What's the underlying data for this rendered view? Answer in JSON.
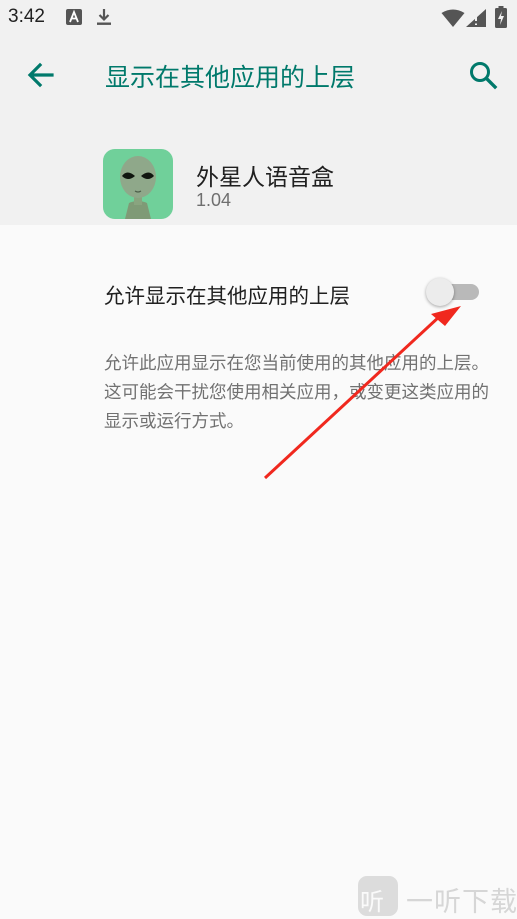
{
  "status_bar": {
    "time": "3:42",
    "icons": [
      "keyboard-a-icon",
      "download-icon",
      "wifi-icon",
      "signal-icon",
      "battery-charging-icon"
    ]
  },
  "app_bar": {
    "back_icon": "arrow-left-icon",
    "title": "显示在其他应用的上层",
    "search_icon": "search-icon"
  },
  "app_info": {
    "name": "外星人语音盒",
    "version": "1.04",
    "icon": "alien-app-icon"
  },
  "setting": {
    "label": "允许显示在其他应用的上层",
    "enabled": false
  },
  "description": "允许此应用显示在您当前使用的其他应用的上层。这可能会干扰您使用相关应用，或变更这类应用的显示或运行方式。",
  "watermark": {
    "glyph": "听",
    "text": "一听下载"
  },
  "colors": {
    "accent": "#00796b",
    "annotation_arrow": "#f0281e",
    "background": "#fafafa",
    "header_background": "#f1f1f1"
  }
}
